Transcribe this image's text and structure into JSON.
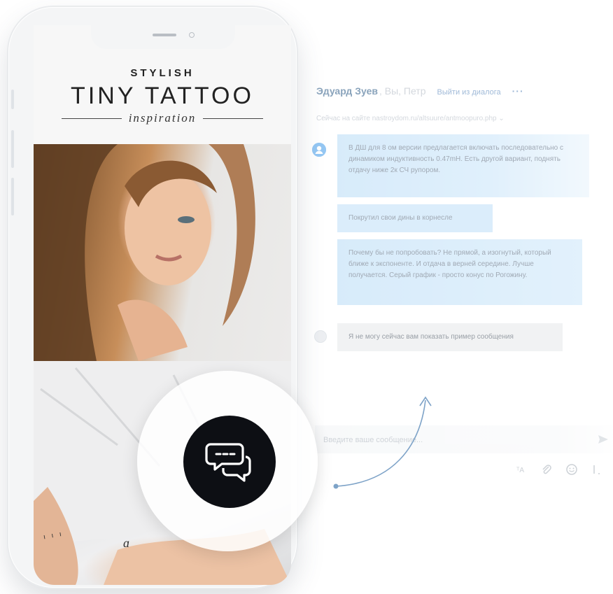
{
  "chat": {
    "header": {
      "name": "Эдуард Зуев",
      "participants": ", Вы, Петр",
      "leave": "Выйти из диалога",
      "more": "···"
    },
    "status": "Сейчас на сайте nastroydom.ru/altsuure/antmoopuro.php ⌄",
    "messages": [
      {
        "text": "В ДШ для 8 ом версии предлагается включать последовательно с динамиком индуктивность 0.47mH. Есть другой вариант, поднять отдачу  ниже 2к СЧ рупором."
      },
      {
        "text": "Покрутил свои дины в корнесле"
      },
      {
        "text": "Почему бы не попробовать? Не прямой, а изогнутый, который ближе к экспоненте. И отдача в верней середине. Лучше получается. Серый график - просто конус по Рогожину."
      },
      {
        "text": "Я не могу сейчас вам показать пример сообщения"
      }
    ],
    "composer_placeholder": "Введите ваше сообщение...",
    "icons": {
      "translate": "translate-icon",
      "attach": "paperclip-icon",
      "emoji": "smile-icon",
      "send": "send-icon"
    }
  },
  "phone": {
    "brand_top": "STYLISH",
    "brand_main": "TINY TATTOO",
    "brand_sub": "inspiration"
  },
  "colors": {
    "accent": "#5181b8",
    "bubble": "#c7e4fa",
    "fab": "#0d0f14"
  }
}
